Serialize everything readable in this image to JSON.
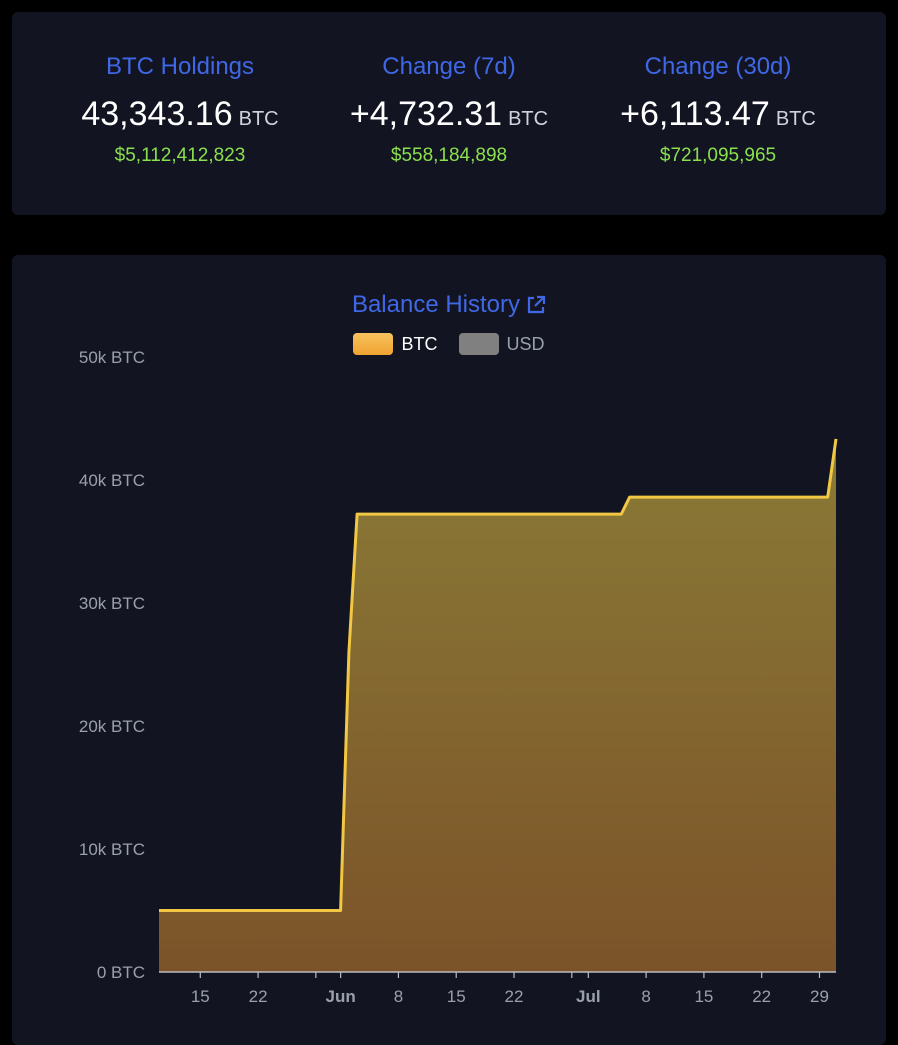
{
  "stats": [
    {
      "title": "BTC Holdings",
      "value": "43,343.16",
      "unit": "BTC",
      "usd": "$5,112,412,823"
    },
    {
      "title": "Change (7d)",
      "value": "+4,732.31",
      "unit": "BTC",
      "usd": "$558,184,898"
    },
    {
      "title": "Change (30d)",
      "value": "+6,113.47",
      "unit": "BTC",
      "usd": "$721,095,965"
    }
  ],
  "chart": {
    "title": "Balance History",
    "legend": [
      {
        "label": "BTC",
        "color": "#f5b041"
      },
      {
        "label": "USD",
        "color": "#808080"
      }
    ]
  },
  "colors": {
    "accent": "#3f67e6",
    "positive": "#8be04e",
    "line": "#f2c744",
    "card": "#121521"
  },
  "chart_data": {
    "type": "area",
    "title": "Balance History",
    "xlabel": "",
    "ylabel": "",
    "ylim": [
      0,
      50000
    ],
    "y_ticks": [
      "0 BTC",
      "10k BTC",
      "20k BTC",
      "30k BTC",
      "40k BTC",
      "50k BTC"
    ],
    "x_ticks": [
      "15",
      "22",
      "Jun",
      "8",
      "15",
      "22",
      "Jul",
      "8",
      "15",
      "22",
      "29"
    ],
    "series": [
      {
        "name": "BTC",
        "x": [
          "2024-05-10",
          "2024-06-01",
          "2024-06-02",
          "2024-06-03",
          "2024-07-05",
          "2024-07-06",
          "2024-07-30",
          "2024-07-31"
        ],
        "values": [
          5000,
          5000,
          26000,
          37230,
          37230,
          38610,
          38610,
          43343
        ]
      }
    ]
  }
}
